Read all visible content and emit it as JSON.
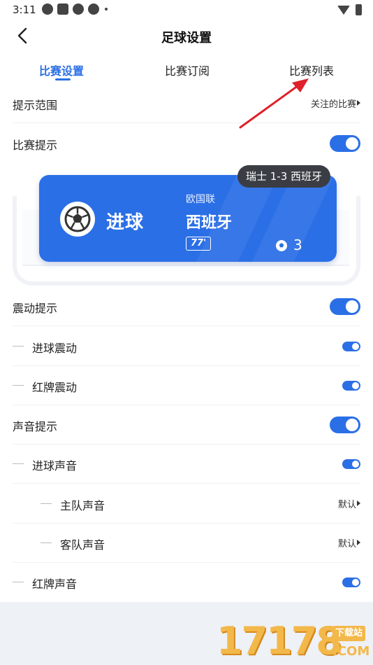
{
  "status_bar": {
    "time": "3:11"
  },
  "header": {
    "title": "足球设置"
  },
  "tabs": [
    {
      "label": "比赛设置",
      "active": true
    },
    {
      "label": "比赛订阅",
      "active": false
    },
    {
      "label": "比赛列表",
      "active": false
    }
  ],
  "settings": {
    "scope": {
      "label": "提示范围",
      "value": "关注的比赛"
    },
    "match_alert": {
      "label": "比赛提示",
      "on": true
    },
    "vibration_alert": {
      "label": "震动提示",
      "on": true
    },
    "goal_vibration": {
      "label": "进球震动",
      "on": true
    },
    "red_card_vibration": {
      "label": "红牌震动",
      "on": true
    },
    "sound_alert": {
      "label": "声音提示",
      "on": true
    },
    "goal_sound": {
      "label": "进球声音",
      "on": true
    },
    "home_sound": {
      "label": "主队声音",
      "value": "默认"
    },
    "away_sound": {
      "label": "客队声音",
      "value": "默认"
    },
    "red_card_sound": {
      "label": "红牌声音",
      "on": true
    }
  },
  "preview": {
    "goal_label": "进球",
    "league": "欧国联",
    "team": "西班牙",
    "minute": "77'",
    "score": "3",
    "tip": "瑞士 1-3 西班牙"
  },
  "watermark": {
    "text": "17178",
    "badge": "下载站",
    "suffix": ".COM"
  },
  "colors": {
    "accent": "#2b6fe6",
    "arrow": "#e0202a",
    "tooltip": "#3a3d44"
  }
}
